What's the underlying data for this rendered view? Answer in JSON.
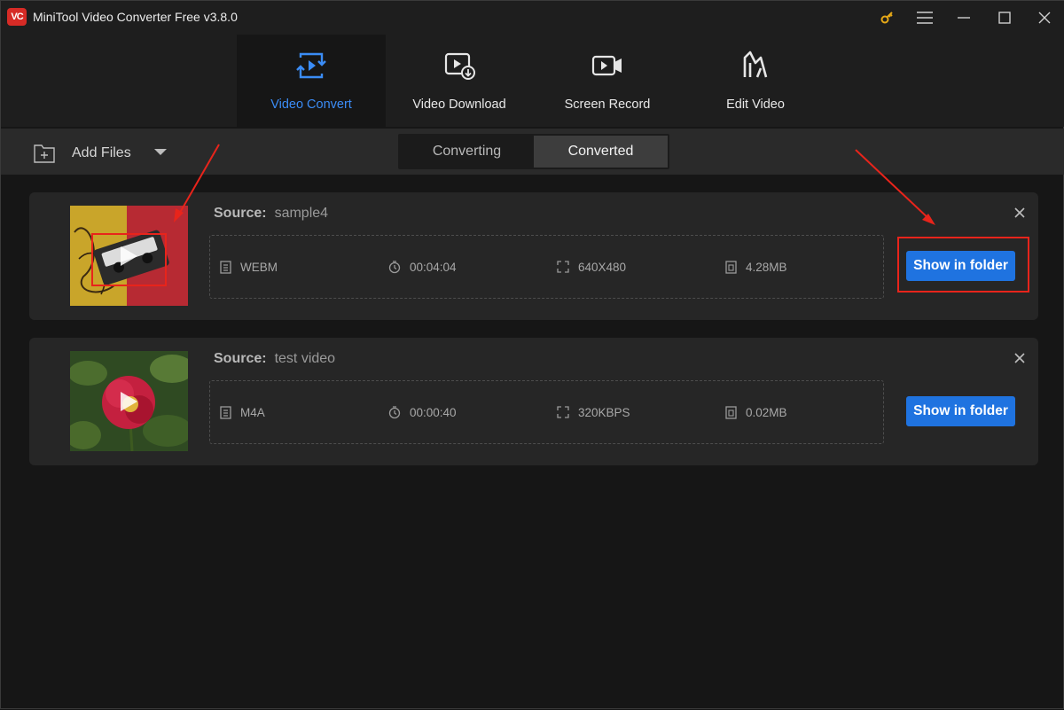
{
  "window": {
    "logo_text": "VC",
    "title": "MiniTool Video Converter Free v3.8.0",
    "icons": [
      "key-icon",
      "menu-icon",
      "minimize-icon",
      "maximize-icon",
      "close-icon"
    ],
    "accent_color": "#3b8cf5"
  },
  "nav": {
    "tabs": [
      {
        "label": "Video Convert",
        "icon": "video-convert-icon",
        "active": true
      },
      {
        "label": "Video Download",
        "icon": "video-download-icon",
        "active": false
      },
      {
        "label": "Screen Record",
        "icon": "screen-record-icon",
        "active": false
      },
      {
        "label": "Edit Video",
        "icon": "edit-video-icon",
        "active": false
      }
    ]
  },
  "toolbar": {
    "add_files_label": "Add Files",
    "segments": [
      {
        "label": "Converting",
        "active": false
      },
      {
        "label": "Converted",
        "active": true
      }
    ]
  },
  "items": [
    {
      "source_key": "Source:",
      "source_name": "sample4",
      "format": "WEBM",
      "duration": "00:04:04",
      "resolution": "640X480",
      "size": "4.28MB",
      "button_label": "Show in folder"
    },
    {
      "source_key": "Source:",
      "source_name": "test video",
      "format": "M4A",
      "duration": "00:00:40",
      "resolution": "320KBPS",
      "size": "0.02MB",
      "button_label": "Show in folder"
    }
  ],
  "colors": {
    "button_blue": "#1f73e0",
    "annotation_red": "#e8241b"
  }
}
